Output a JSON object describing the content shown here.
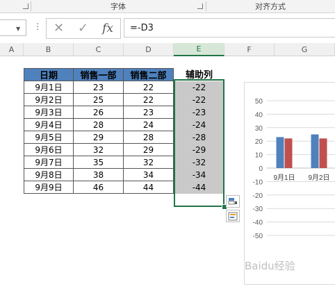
{
  "ribbon": {
    "groups": [
      "字体",
      "对齐方式"
    ]
  },
  "formula_bar": {
    "formula": "=-D3"
  },
  "columns": [
    "A",
    "B",
    "C",
    "D",
    "E",
    "F",
    "G"
  ],
  "table": {
    "headers": [
      "日期",
      "销售一部",
      "销售二部"
    ],
    "aux_header": "辅助列",
    "rows": [
      {
        "date": "9月1日",
        "s1": "23",
        "s2": "22",
        "aux": "-22"
      },
      {
        "date": "9月2日",
        "s1": "25",
        "s2": "22",
        "aux": "-22"
      },
      {
        "date": "9月3日",
        "s1": "26",
        "s2": "23",
        "aux": "-23"
      },
      {
        "date": "9月4日",
        "s1": "28",
        "s2": "24",
        "aux": "-24"
      },
      {
        "date": "9月5日",
        "s1": "29",
        "s2": "28",
        "aux": "-28"
      },
      {
        "date": "9月6日",
        "s1": "32",
        "s2": "29",
        "aux": "-29"
      },
      {
        "date": "9月7日",
        "s1": "35",
        "s2": "32",
        "aux": "-32"
      },
      {
        "date": "9月8日",
        "s1": "38",
        "s2": "34",
        "aux": "-34"
      },
      {
        "date": "9月9日",
        "s1": "46",
        "s2": "44",
        "aux": "-44"
      }
    ]
  },
  "colors": {
    "header_fill": "#4f81bd",
    "aux_fill": "#c9c9c9",
    "selection": "#217346",
    "series1": "#4f81bd",
    "series2": "#c0504d"
  },
  "chart_data": {
    "type": "bar",
    "categories": [
      "9月1日",
      "9月2日"
    ],
    "series": [
      {
        "values": [
          23,
          25
        ]
      },
      {
        "values": [
          22,
          22
        ]
      }
    ],
    "yticks": [
      "50",
      "40",
      "30",
      "20",
      "10",
      "0",
      "-10",
      "-20",
      "-30",
      "-40",
      "-50"
    ],
    "ylim": [
      -50,
      50
    ],
    "grid": true
  },
  "watermark": "Baidu经验"
}
